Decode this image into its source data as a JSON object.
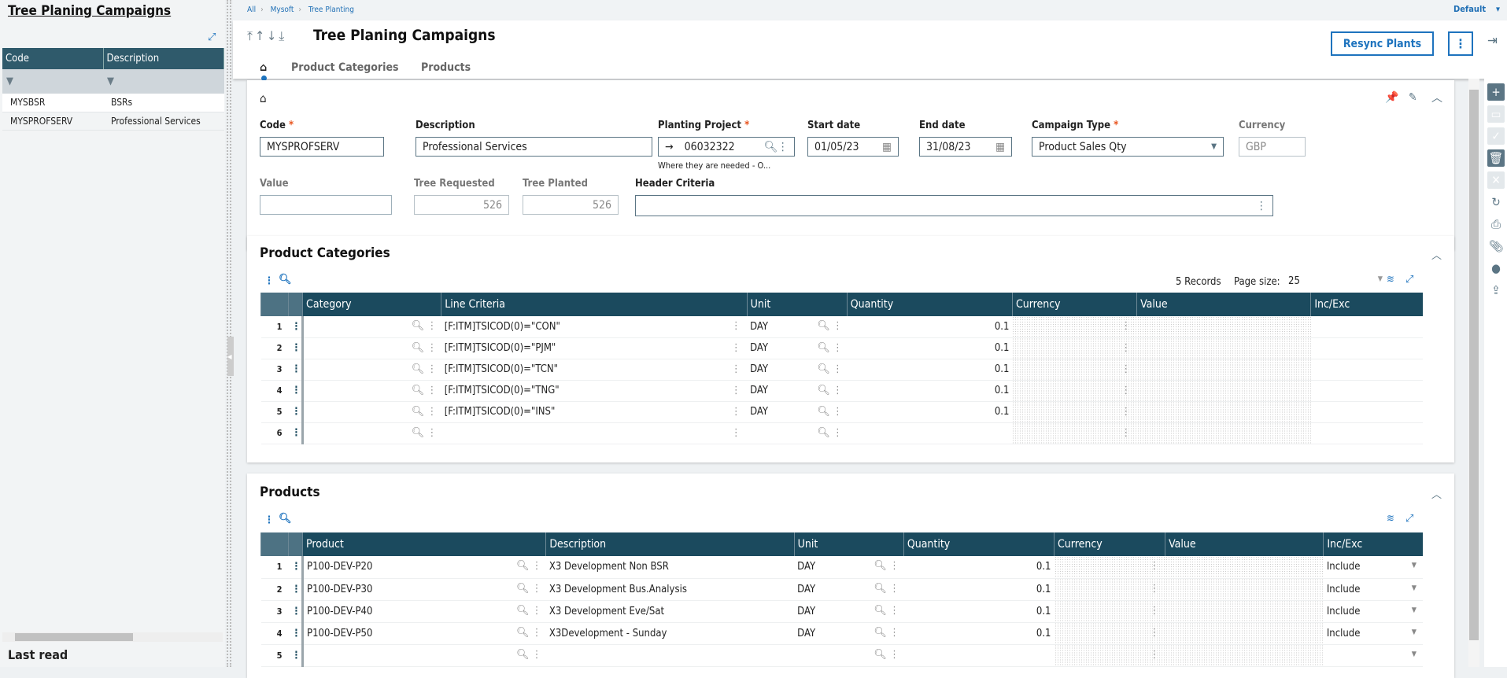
{
  "left_panel": {
    "title": "Tree Planing Campaigns",
    "columns": [
      "Code",
      "Description"
    ],
    "rows": [
      {
        "code": "MYSBSR",
        "description": "BSRs"
      },
      {
        "code": "MYSPROFSERV",
        "description": "Professional Services"
      }
    ],
    "footer": "Last read"
  },
  "breadcrumb": [
    "All",
    "Mysoft",
    "Tree Planting"
  ],
  "profile": "Default",
  "header": {
    "title": "Tree Planing Campaigns",
    "tabs": [
      "Product Categories",
      "Products"
    ],
    "resync_label": "Resync Plants"
  },
  "form": {
    "code": {
      "label": "Code",
      "value": "MYSPROFSERV"
    },
    "description": {
      "label": "Description",
      "value": "Professional Services"
    },
    "planting_project": {
      "label": "Planting Project",
      "value": "06032322",
      "hint": "Where they are needed - O..."
    },
    "start_date": {
      "label": "Start date",
      "value": "01/05/23"
    },
    "end_date": {
      "label": "End date",
      "value": "31/08/23"
    },
    "campaign_type": {
      "label": "Campaign Type",
      "value": "Product Sales Qty"
    },
    "currency": {
      "label": "Currency",
      "value": "GBP"
    },
    "value": {
      "label": "Value",
      "value": ""
    },
    "tree_requested": {
      "label": "Tree Requested",
      "value": "526"
    },
    "tree_planted": {
      "label": "Tree Planted",
      "value": "526"
    },
    "header_criteria": {
      "label": "Header Criteria",
      "value": ""
    }
  },
  "categories": {
    "title": "Product Categories",
    "records": "5 Records",
    "page_size_label": "Page size:",
    "page_size": "25",
    "columns": [
      "Category",
      "Line Criteria",
      "Unit",
      "Quantity",
      "Currency",
      "Value",
      "Inc/Exc"
    ],
    "rows": [
      [
        "",
        "[F:ITM]TSICOD(0)=\"CON\"",
        "DAY",
        "0.1",
        "",
        "",
        ""
      ],
      [
        "",
        "[F:ITM]TSICOD(0)=\"PJM\"",
        "DAY",
        "0.1",
        "",
        "",
        ""
      ],
      [
        "",
        "[F:ITM]TSICOD(0)=\"TCN\"",
        "DAY",
        "0.1",
        "",
        "",
        ""
      ],
      [
        "",
        "[F:ITM]TSICOD(0)=\"TNG\"",
        "DAY",
        "0.1",
        "",
        "",
        ""
      ],
      [
        "",
        "[F:ITM]TSICOD(0)=\"INS\"",
        "DAY",
        "0.1",
        "",
        "",
        ""
      ],
      [
        "",
        "",
        "",
        "",
        "",
        "",
        ""
      ]
    ]
  },
  "products": {
    "title": "Products",
    "columns": [
      "Product",
      "Description",
      "Unit",
      "Quantity",
      "Currency",
      "Value",
      "Inc/Exc"
    ],
    "rows": [
      [
        "P100-DEV-P20",
        "X3 Development Non BSR",
        "DAY",
        "0.1",
        "",
        "",
        "Include"
      ],
      [
        "P100-DEV-P30",
        "X3 Development Bus.Analysis",
        "DAY",
        "0.1",
        "",
        "",
        "Include"
      ],
      [
        "P100-DEV-P40",
        "X3 Development Eve/Sat",
        "DAY",
        "0.1",
        "",
        "",
        "Include"
      ],
      [
        "P100-DEV-P50",
        "X3Development - Sunday",
        "DAY",
        "0.1",
        "",
        "",
        "Include"
      ],
      [
        "",
        "",
        "",
        "",
        "",
        "",
        ""
      ]
    ]
  },
  "colors": {
    "header_bg": "#1b4a5e",
    "accent": "#1e73be",
    "required": "#e8531d"
  }
}
